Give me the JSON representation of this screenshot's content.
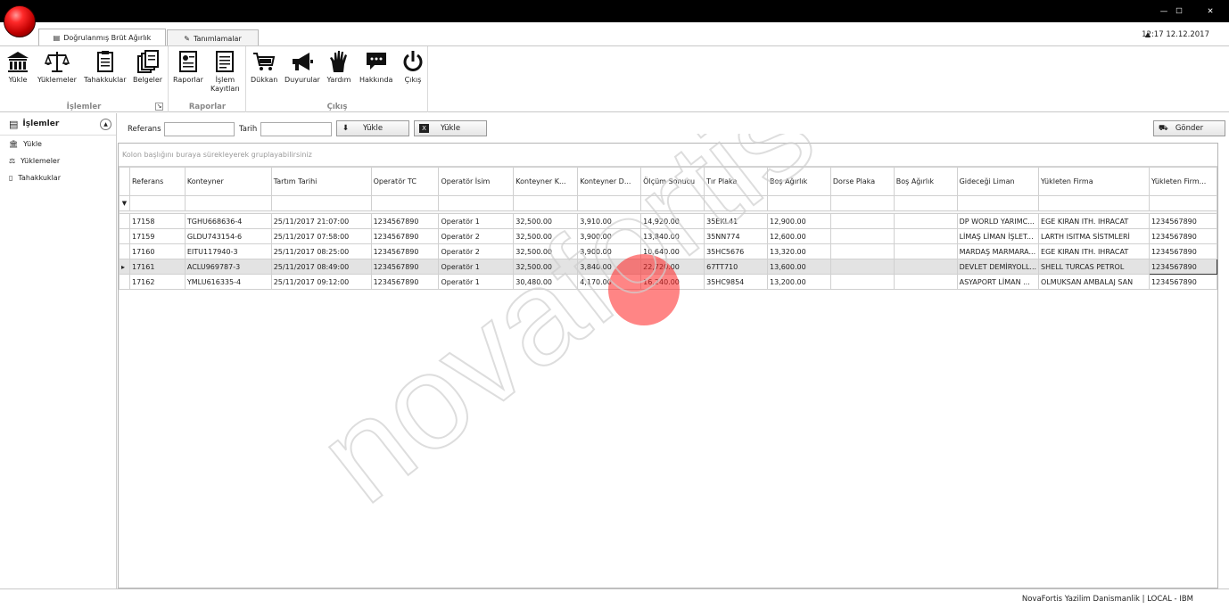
{
  "window": {
    "minimize": "—",
    "maximize": "☐",
    "close": "✕"
  },
  "tabs": [
    {
      "label": "Doğrulanmış Brüt Ağırlık"
    },
    {
      "label": "Tanımlamalar"
    }
  ],
  "clock": "12:17 12.12.2017",
  "ribbon": {
    "groups": [
      {
        "caption": "İşlemler",
        "buttons": [
          "Yükle",
          "Yüklemeler",
          "Tahakkuklar",
          "Belgeler"
        ]
      },
      {
        "caption": "Raporlar",
        "buttons": [
          "Raporlar",
          "İşlem\nKayıtları"
        ]
      },
      {
        "caption": "Çıkış",
        "buttons": [
          "Dükkan",
          "Duyurular",
          "Yardım",
          "Hakkında",
          "Çıkış"
        ]
      }
    ]
  },
  "sidebar": {
    "title": "İşlemler",
    "items": [
      {
        "label": "Yükle",
        "icon": "bank-icon"
      },
      {
        "label": "Yüklemeler",
        "icon": "scale-icon"
      },
      {
        "label": "Tahakkuklar",
        "icon": "document-icon"
      }
    ]
  },
  "filter": {
    "ref_label": "Referans",
    "date_label": "Tarih",
    "load_btn": "Yükle",
    "excel_btn": "Yükle",
    "send_btn": "Gönder"
  },
  "grid": {
    "group_hint": "Kolon başlığını buraya sürekleyerek gruplayabilirsiniz",
    "columns": [
      "Referans",
      "Konteyner",
      "Tartım Tarihi",
      "Operatör TC",
      "Operatör İsim",
      "Konteyner K...",
      "Konteyner D...",
      "Ölçüm Sonucu",
      "Tır Plaka",
      "Boş Ağırlık",
      "Dorse Plaka",
      "Boş Ağırlık",
      "Gideceği Liman",
      "Yükleten Firma",
      "Yükleten Firm..."
    ],
    "rows": [
      [
        "17158",
        "TGHU668636-4",
        "25/11/2017 21:07:00",
        "1234567890",
        "Operatör 1",
        "32,500.00",
        "3,910.00",
        "14,920.00",
        "35EKL41",
        "12,900.00",
        "",
        "",
        "DP WORLD YARIMC...",
        "EGE KIRAN ITH. IHRACAT",
        "1234567890"
      ],
      [
        "17159",
        "GLDU743154-6",
        "25/11/2017 07:58:00",
        "1234567890",
        "Operatör 2",
        "32,500.00",
        "3,900.00",
        "13,840.00",
        "35NN774",
        "12,600.00",
        "",
        "",
        "LİMAŞ LİMAN İŞLET...",
        "LARTH ISITMA SİSTMLERİ",
        "1234567890"
      ],
      [
        "17160",
        "EITU117940-3",
        "25/11/2017 08:25:00",
        "1234567890",
        "Operatör 2",
        "32,500.00",
        "3,900.00",
        "10,640.00",
        "35HC5676",
        "13,320.00",
        "",
        "",
        "MARDAŞ MARMARA...",
        "EGE KIRAN ITH. IHRACAT",
        "1234567890"
      ],
      [
        "17161",
        "ACLU969787-3",
        "25/11/2017 08:49:00",
        "1234567890",
        "Operatör 1",
        "32,500.00",
        "3,840.00",
        "22,720.00",
        "67TT710",
        "13,600.00",
        "",
        "",
        "DEVLET DEMİRYOLL...",
        "SHELL TURCAS PETROL",
        "1234567890"
      ],
      [
        "17162",
        "YMLU616335-4",
        "25/11/2017 09:12:00",
        "1234567890",
        "Operatör 1",
        "30,480.00",
        "4,170.00",
        "16,240.00",
        "35HC9854",
        "13,200.00",
        "",
        "",
        "ASYAPORT LİMAN ...",
        "OLMUKSAN AMBALAJ SAN",
        "1234567890"
      ]
    ],
    "selected_row": 3
  },
  "status": "NovaFortis Yazilim Danismanlik | LOCAL - IBM",
  "watermark": "novafortis",
  "colors": {
    "logo": "#e00000",
    "titlebar": "#000000"
  }
}
